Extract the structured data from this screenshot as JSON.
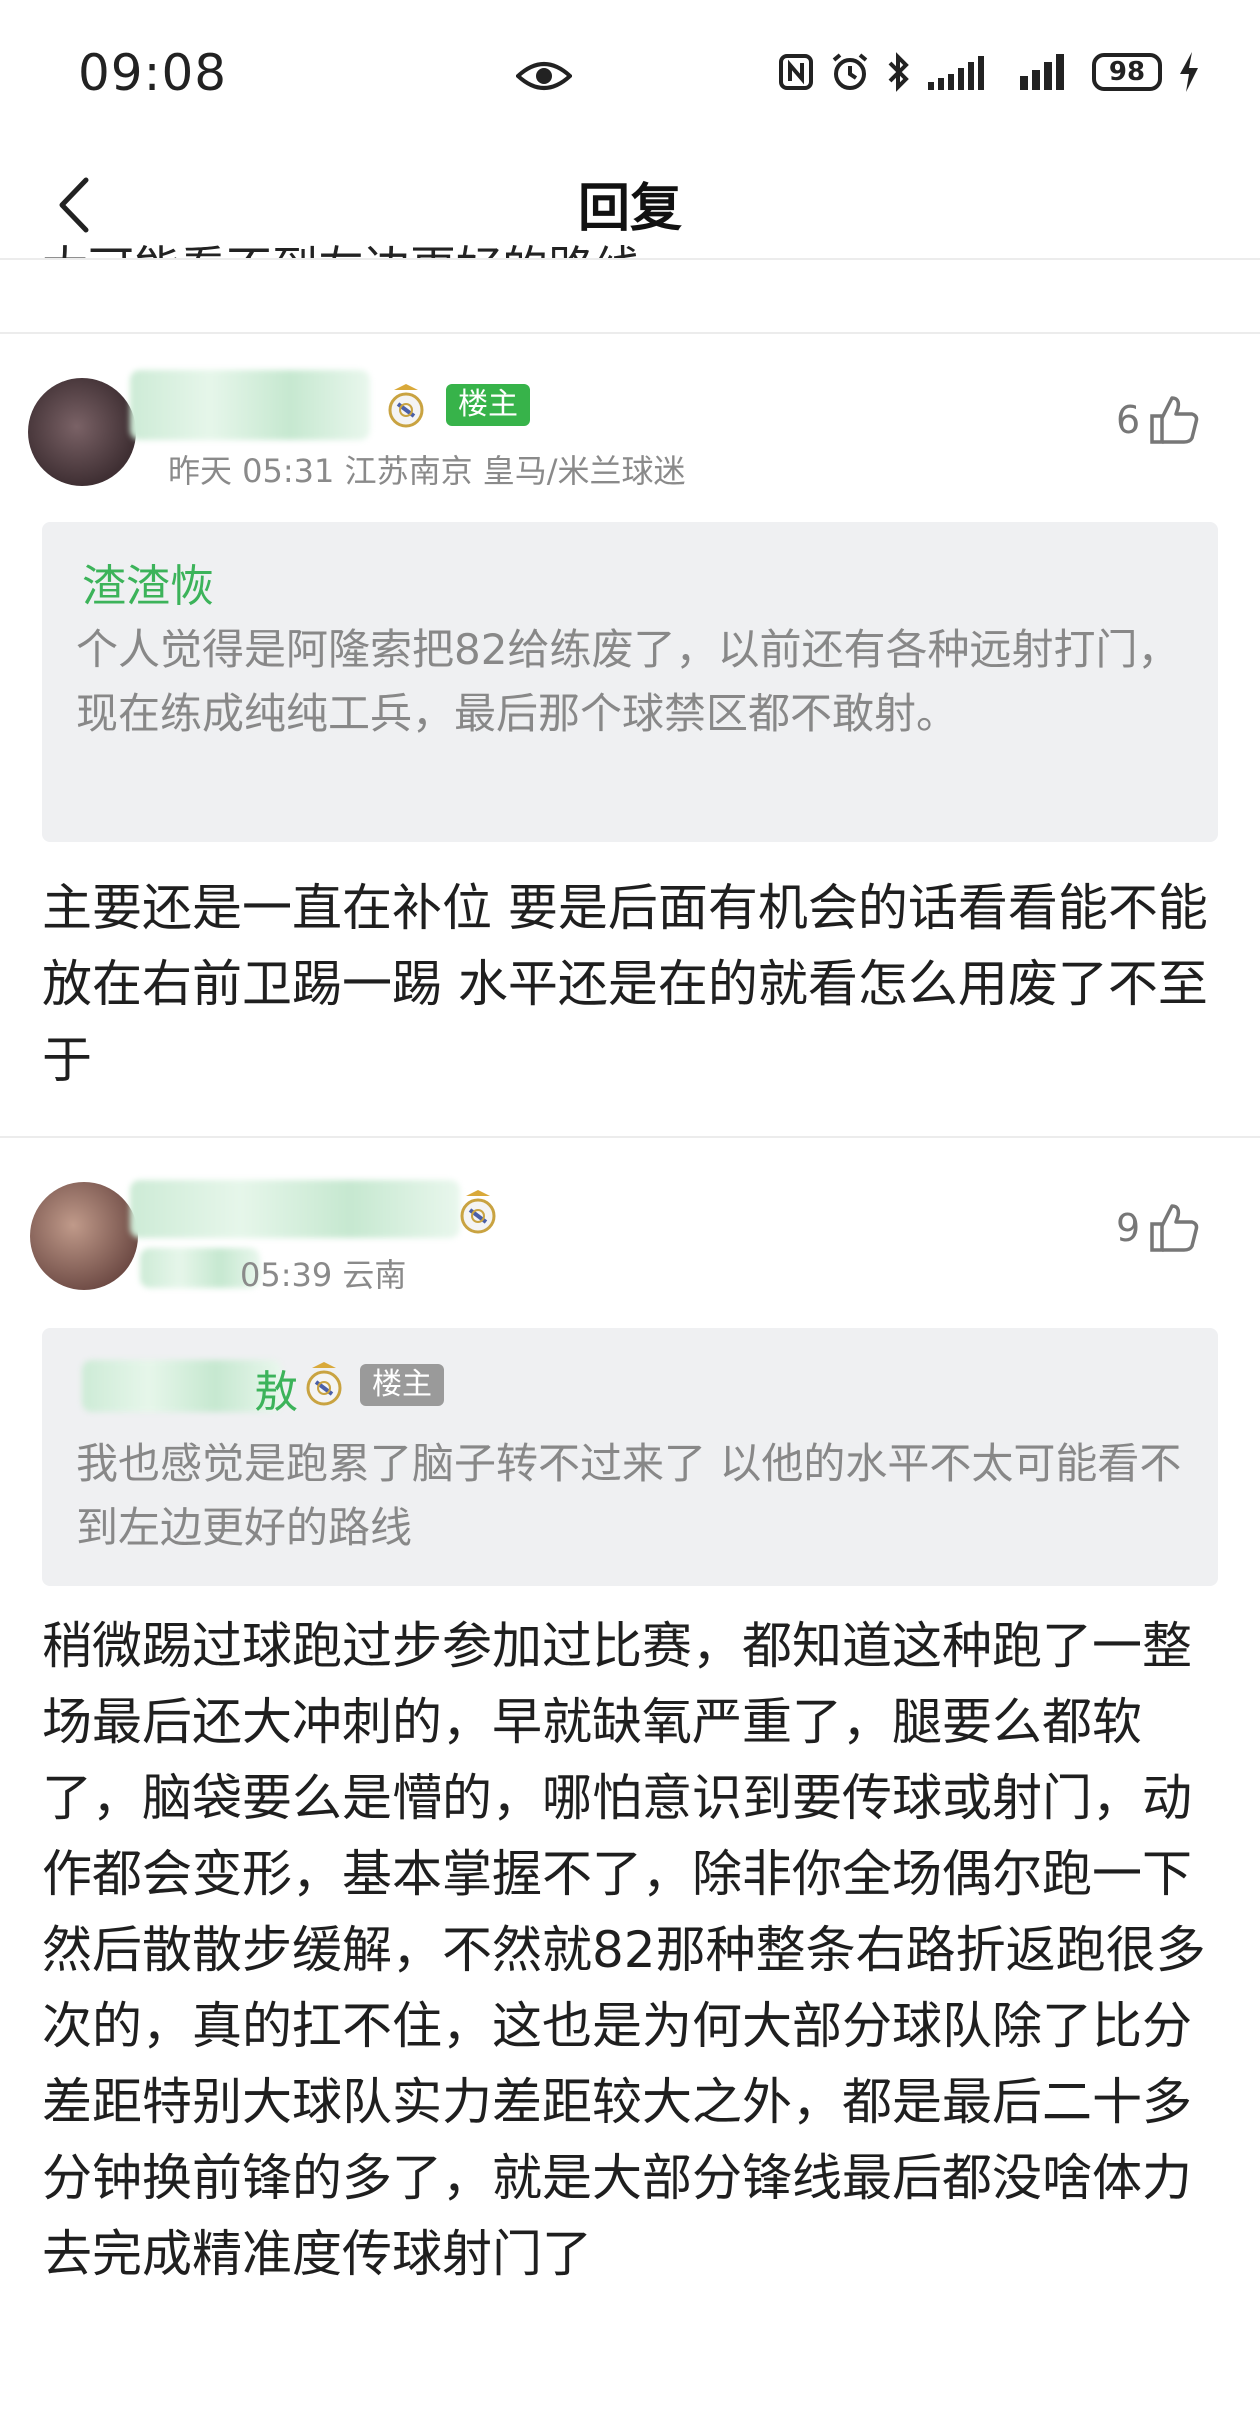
{
  "status_bar": {
    "time": "09:08",
    "battery": "98",
    "icons": [
      "eye-icon",
      "nfc-icon",
      "alarm-icon",
      "bluetooth-icon",
      "signal-icon",
      "signal-icon",
      "battery-icon",
      "charging-icon"
    ]
  },
  "header": {
    "title": "回复",
    "cut_line": "太可能看不到左边更好的路线"
  },
  "comments": [
    {
      "owner_tag": "楼主",
      "meta": "昨天 05:31  江苏南京  皇马/米兰球迷",
      "likes": "6",
      "quote_author": "渣渣恢",
      "quote_text": "个人觉得是阿隆索把82给练废了，以前还有各种远射打门，现在练成纯纯工兵，最后那个球禁区都不敢射。",
      "body": "主要还是一直在补位 要是后面有机会的话看看能不能放在右前卫踢一踢 水平还是在的就看怎么用废了不至于"
    },
    {
      "meta": "05:39  云南",
      "likes": "9",
      "quote_author_visible": "敖",
      "quote_owner_tag": "楼主",
      "quote_text": "我也感觉是跑累了脑子转不过来了 以他的水平不太可能看不到左边更好的路线",
      "body": "稍微踢过球跑过步参加过比赛，都知道这种跑了一整场最后还大冲刺的，早就缺氧严重了，腿要么都软了，脑袋要么是懵的，哪怕意识到要传球或射门，动作都会变形，基本掌握不了，除非你全场偶尔跑一下然后散散步缓解，不然就82那种整条右路折返跑很多次的，真的扛不住，这也是为何大部分球队除了比分差距特别大球队实力差距较大之外，都是最后二十多分钟换前锋的多了，就是大部分锋线最后都没啥体力去完成精准度传球射门了"
    }
  ],
  "colors": {
    "accent_green": "#3cb35a",
    "owner_tag_green": "#37b34a",
    "owner_tag_gray": "#9a9a9a",
    "quote_bg": "#eff0f2"
  }
}
